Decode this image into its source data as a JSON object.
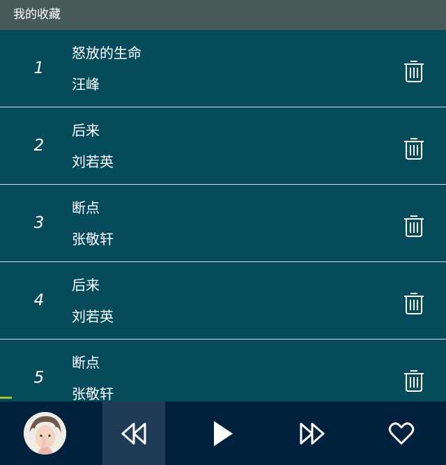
{
  "header": {
    "title": "我的收藏"
  },
  "playlist": [
    {
      "index": "1",
      "song": "怒放的生命",
      "artist": "汪峰"
    },
    {
      "index": "2",
      "song": "后来",
      "artist": "刘若英"
    },
    {
      "index": "3",
      "song": "断点",
      "artist": "张敬轩"
    },
    {
      "index": "4",
      "song": "后来",
      "artist": "刘若英"
    },
    {
      "index": "5",
      "song": "断点",
      "artist": "张敬轩"
    }
  ],
  "colors": {
    "header_bg": "#475a58",
    "list_bg": "#064b5c",
    "player_bg": "#00213d",
    "active_control_bg": "#1f3b55",
    "progress": "#a7c426"
  },
  "icons": {
    "delete": "trash-icon",
    "prev": "rewind-icon",
    "play": "play-icon",
    "next": "fast-forward-icon",
    "favorite": "heart-icon"
  },
  "playback": {
    "progress_fraction": 0.027
  }
}
